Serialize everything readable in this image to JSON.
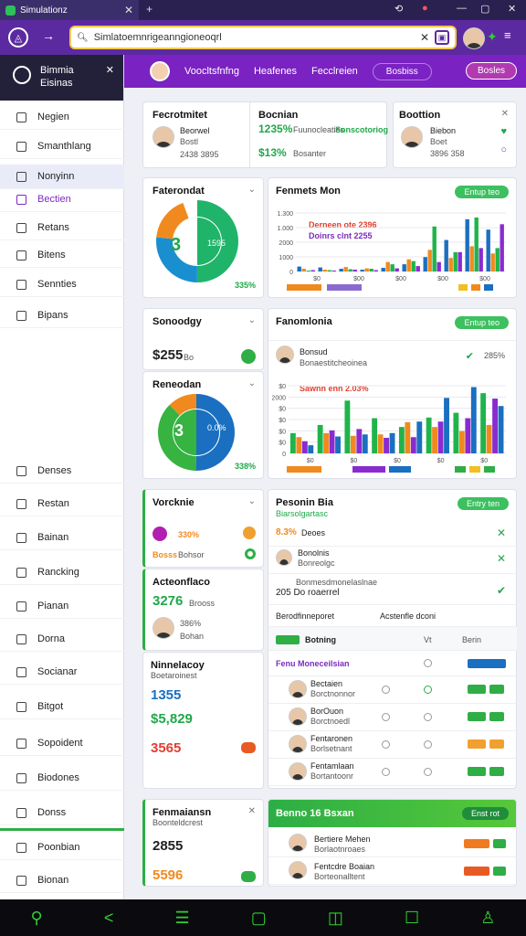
{
  "browser": {
    "tab_title": "Simulationz",
    "url": "Simlatoemnrigeanngioneoqrl"
  },
  "sidebar": {
    "title_line1": "Bimmia",
    "title_line2": "Eisinas",
    "items": [
      {
        "label": "Negien"
      },
      {
        "label": "Smanthlang"
      },
      {
        "label": "Nonyinn"
      },
      {
        "label": "Bectien"
      },
      {
        "label": "Retans"
      },
      {
        "label": "Bitens"
      },
      {
        "label": "Sennties"
      },
      {
        "label": "Bipans"
      },
      {
        "label": "Denses"
      },
      {
        "label": "Restan"
      },
      {
        "label": "Bainan"
      },
      {
        "label": "Rancking"
      },
      {
        "label": "Pianan"
      },
      {
        "label": "Dorna"
      },
      {
        "label": "Socianar"
      },
      {
        "label": "Bitgot"
      },
      {
        "label": "Sopoident"
      },
      {
        "label": "Biodones"
      },
      {
        "label": "Donss"
      },
      {
        "label": "Poonbian"
      },
      {
        "label": "Bionan"
      }
    ]
  },
  "header": {
    "user": "Voocltsfnfng",
    "nav1": "Heafenes",
    "nav2": "Fecclreien",
    "pill": "Bosbiss",
    "button": "Bosles"
  },
  "top_cards": {
    "c1": {
      "title": "Fecrotmitet",
      "name": "Beorwel",
      "sub": "Bostl",
      "val": "2438 3895"
    },
    "c2": {
      "title": "Bocnian",
      "pct1": "1235%",
      "txt1": "Fuunocleaties",
      "tag": "Sonscotoriog",
      "pct2": "$13%",
      "txt2": "Bosanter"
    },
    "c3": {
      "title": "Boottion",
      "name": "Biebon",
      "sub": "Boet",
      "val": "3896 358"
    }
  },
  "donut1": {
    "title": "Faterondat",
    "center": "3",
    "label": "1595",
    "pct": "335%"
  },
  "chart1": {
    "title": "Fenmets Mon",
    "button": "Entup teo",
    "legend1": "Derneen ote 2396",
    "legend2": "Doinrs clnt 2255"
  },
  "mid_cards": {
    "c1": {
      "title": "Sonoodgy",
      "val": "$255",
      "sub": "Bo"
    },
    "donut2": {
      "title": "Reneodan",
      "center": "3",
      "label": "0.0%",
      "pct": "338%"
    }
  },
  "chart2": {
    "title": "Fanomlonia",
    "button": "Entup teo",
    "name": "Bonsud",
    "sub": "Bonaestitcheoinea",
    "pct": "285%",
    "legend": "Sawnn enn 2.03%"
  },
  "left_lists": {
    "c1": {
      "title": "Vorcknie",
      "val1": "330%",
      "val2": "Bosss",
      "val3": "Bohsor"
    },
    "c2": {
      "title": "Acteonflaco",
      "val1": "3276",
      "val2": "Brooss",
      "val3": "386%",
      "val4": "Bohan"
    },
    "c3": {
      "title": "Ninnelacoy",
      "sub": "Boetaroinest",
      "val1": "1355",
      "val2": "$5,829",
      "val3": "3565"
    },
    "c4": {
      "title": "Fenmaiansn",
      "sub": "Boonteldcrest",
      "val1": "2855",
      "val2": "5596"
    }
  },
  "big_panel": {
    "title": "Pesonin Bia",
    "sub": "Biarsolgartasc",
    "button": "Entry ten",
    "row1": {
      "pct": "8.3%",
      "txt": "Deoes"
    },
    "row2": {
      "name": "Bonolnis",
      "txt": "Bonreolgc"
    },
    "row3": {
      "txt": "Bonmesdmonelaslnae",
      "val": "205 Do roaerrel"
    },
    "col1": "Berodfinneporet",
    "col2": "Acstenfle dconi",
    "tbl_head": {
      "label": "Botning",
      "c2": "Vt",
      "c3": "Berin"
    },
    "link": "Fenu Moneceilsian",
    "rows": [
      {
        "name": "Bectaien",
        "sub": "Borctnonnor"
      },
      {
        "name": "BorOuon",
        "sub": "Borctnoedl"
      },
      {
        "name": "Fentaronen",
        "sub": "Borlsetnant"
      },
      {
        "name": "Fentamlaan",
        "sub": "Bortantoonr"
      }
    ]
  },
  "bottom_panel": {
    "title": "Benno 16 Bsxan",
    "button": "Enst rot",
    "rows": [
      {
        "name": "Bertiere Mehen",
        "sub": "Borlaotnroaes"
      },
      {
        "name": "Fentcdre Boaian",
        "sub": "Borteonalltent"
      }
    ]
  },
  "chart_data": [
    {
      "type": "bar",
      "title": "Fenmets Mon",
      "y_ticks": [
        "1.300",
        "1.000",
        "2000",
        "1000",
        "0"
      ],
      "x_ticks": [
        "$0",
        "$00",
        "$00",
        "$00",
        "$00"
      ],
      "ylim": [
        0,
        1300
      ],
      "series": [
        {
          "name": "Derneen ote 2396",
          "color": "#1a6fc0",
          "values": [
            110,
            90,
            60,
            40,
            80,
            160,
            320,
            700,
            1160,
            930
          ]
        },
        {
          "name": "Doinrs clnt 2255",
          "color": "#f08a1e",
          "values": [
            60,
            40,
            100,
            70,
            210,
            270,
            480,
            300,
            560,
            400
          ]
        },
        {
          "name": "green",
          "color": "#1fb44a",
          "values": [
            20,
            30,
            50,
            60,
            160,
            230,
            1000,
            430,
            1200,
            520
          ]
        },
        {
          "name": "purple",
          "color": "#8a2bd0",
          "values": [
            30,
            20,
            40,
            30,
            70,
            120,
            210,
            430,
            520,
            1050
          ]
        }
      ]
    },
    {
      "type": "bar",
      "title": "Fanomlonia",
      "y_ticks": [
        "$0",
        "2000",
        "$0",
        "$0",
        "$0",
        "$0",
        "0"
      ],
      "x_ticks": [
        "$0",
        "$0",
        "$0",
        "$0",
        "$0"
      ],
      "ylim": [
        0,
        1000
      ],
      "series": [
        {
          "name": "green",
          "color": "#1fb44a",
          "values": [
            300,
            420,
            780,
            520,
            390,
            530,
            600,
            890
          ]
        },
        {
          "name": "orange",
          "color": "#f08a1e",
          "values": [
            240,
            300,
            260,
            280,
            460,
            390,
            330,
            420
          ]
        },
        {
          "name": "purple",
          "color": "#8a2bd0",
          "values": [
            180,
            340,
            360,
            230,
            240,
            470,
            520,
            810
          ]
        },
        {
          "name": "blue",
          "color": "#1a6fc0",
          "values": [
            120,
            250,
            280,
            300,
            470,
            820,
            980,
            700
          ]
        }
      ]
    }
  ]
}
